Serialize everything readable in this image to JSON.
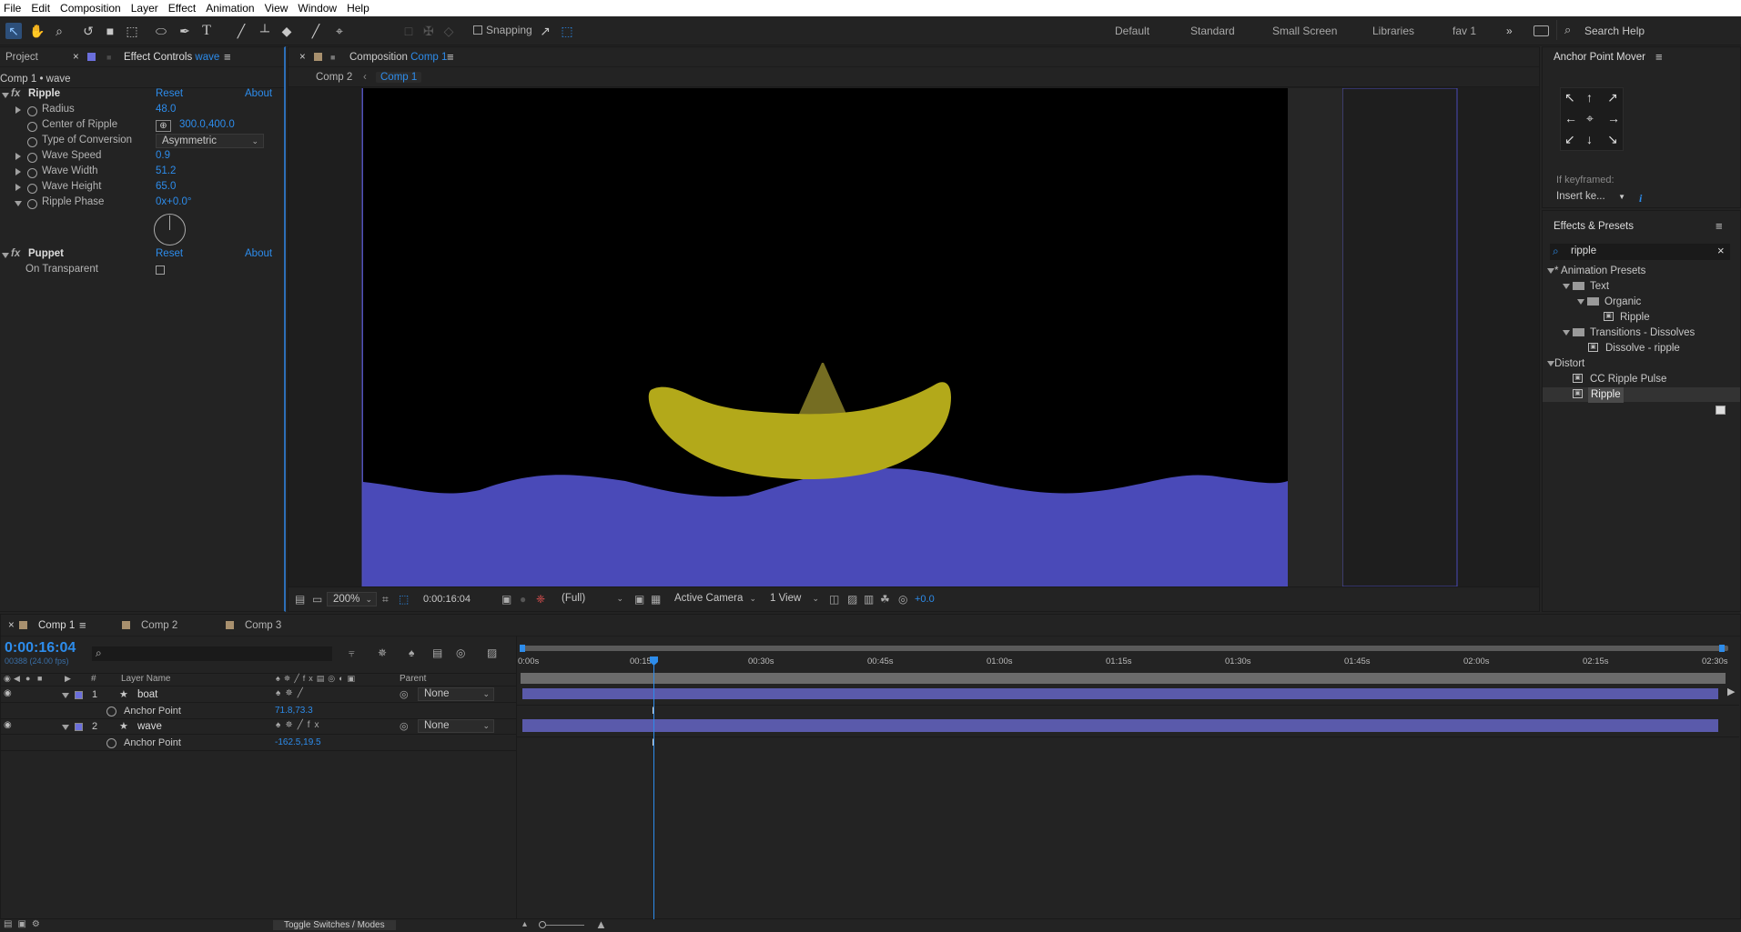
{
  "menu": [
    "File",
    "Edit",
    "Composition",
    "Layer",
    "Effect",
    "Animation",
    "View",
    "Window",
    "Help"
  ],
  "toolbar": {
    "snapping_label": "Snapping",
    "workspaces": [
      "Default",
      "Standard",
      "Small Screen",
      "Libraries",
      "fav 1"
    ],
    "search_placeholder": "Search Help"
  },
  "left_panel": {
    "tab_project": "Project",
    "tab_effect_controls": "Effect Controls",
    "tab_layer": "wave",
    "breadcrumb": "Comp 1 • wave",
    "effects": [
      {
        "name": "Ripple",
        "reset": "Reset",
        "about": "About"
      },
      {
        "name": "Puppet",
        "reset": "Reset",
        "about": "About"
      }
    ],
    "ripple_props": [
      {
        "label": "Radius",
        "value": "48.0"
      },
      {
        "label": "Center of Ripple",
        "value": "300.0,400.0"
      },
      {
        "label": "Type of Conversion",
        "value": "Asymmetric"
      },
      {
        "label": "Wave Speed",
        "value": "0.9"
      },
      {
        "label": "Wave Width",
        "value": "51.2"
      },
      {
        "label": "Wave Height",
        "value": "65.0"
      },
      {
        "label": "Ripple Phase",
        "value": "0x+0.0°"
      }
    ],
    "puppet_props": [
      {
        "label": "On Transparent"
      }
    ]
  },
  "comp_panel": {
    "title_prefix": "Composition",
    "title_comp": "Comp 1",
    "breadcrumbs": [
      "Comp 2",
      "Comp 1"
    ],
    "footer": {
      "zoom": "200%",
      "timecode": "0:00:16:04",
      "resolution": "(Full)",
      "camera": "Active Camera",
      "view": "1 View",
      "exposure": "+0.0"
    }
  },
  "anchor_panel": {
    "title": "Anchor Point Mover",
    "if_keyframed": "If keyframed:",
    "insert_option": "Insert ke..."
  },
  "effects_presets": {
    "title": "Effects & Presets",
    "search_value": "ripple",
    "tree": [
      {
        "label": "* Animation Presets"
      },
      {
        "label": "Text"
      },
      {
        "label": "Organic"
      },
      {
        "label": "Ripple"
      },
      {
        "label": "Transitions - Dissolves"
      },
      {
        "label": "Dissolve - ripple"
      },
      {
        "label": "Distort"
      },
      {
        "label": "CC Ripple Pulse"
      },
      {
        "label": "Ripple"
      }
    ]
  },
  "timeline": {
    "tabs": [
      "Comp 1",
      "Comp 2",
      "Comp 3"
    ],
    "timecode": "0:00:16:04",
    "frame_info": "00388 (24.00 fps)",
    "col_layer_name": "Layer Name",
    "col_num": "#",
    "col_parent": "Parent",
    "ruler": [
      "0:00s",
      "00:15s",
      "00:30s",
      "00:45s",
      "01:00s",
      "01:15s",
      "01:30s",
      "01:45s",
      "02:00s",
      "02:15s",
      "02:30s"
    ],
    "layers": [
      {
        "num": "1",
        "name": "boat",
        "parent": "None",
        "prop": "Anchor Point",
        "prop_value": "71.8,73.3"
      },
      {
        "num": "2",
        "name": "wave",
        "parent": "None",
        "prop": "Anchor Point",
        "prop_value": "-162.5,19.5"
      }
    ],
    "toggle_label": "Toggle Switches / Modes"
  },
  "colors": {
    "accent": "#2d8ceb",
    "label_purple": "#6b6fdc",
    "wave": "#4a4ab8",
    "boat": "#b3a91a",
    "sail": "#756d22",
    "track_bar": "#5a5aab"
  }
}
